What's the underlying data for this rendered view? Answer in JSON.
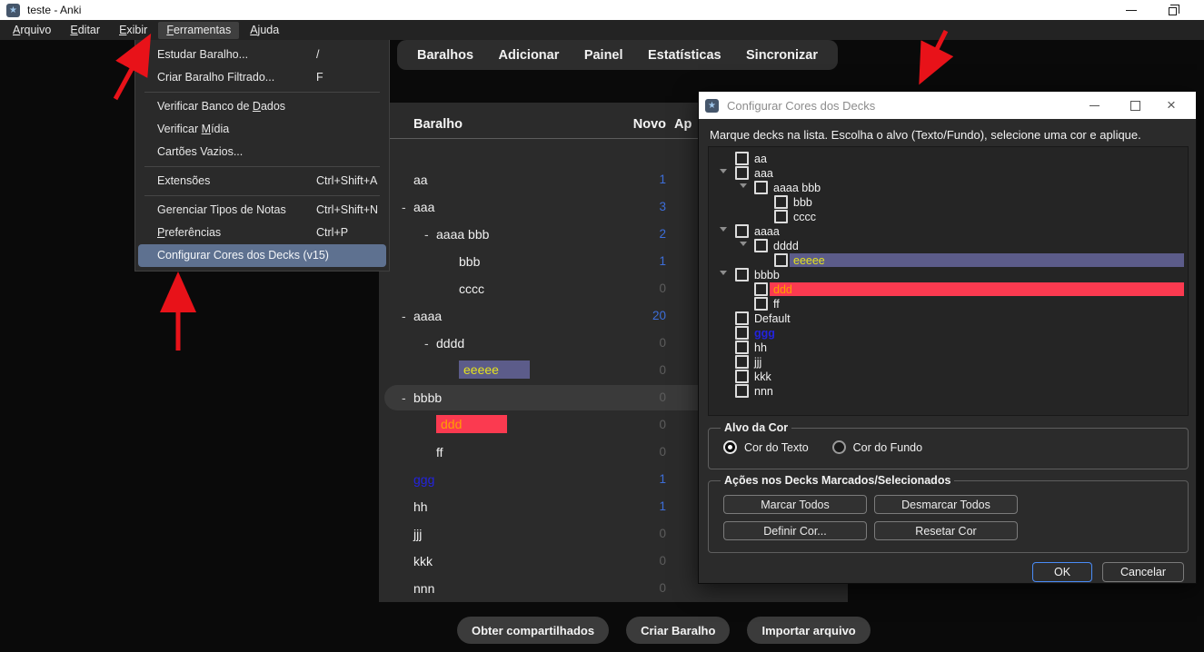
{
  "window": {
    "title": "teste - Anki"
  },
  "menubar": {
    "items": [
      {
        "label": "Arquivo",
        "accel": 0
      },
      {
        "label": "Editar",
        "accel": 0
      },
      {
        "label": "Exibir",
        "accel": 0
      },
      {
        "label": "Ferramentas",
        "accel": 0,
        "active": true
      },
      {
        "label": "Ajuda",
        "accel": 0
      }
    ]
  },
  "tools_menu": {
    "items": [
      {
        "label": "Estudar Baralho...",
        "shortcut": "/"
      },
      {
        "label": "Criar Baralho Filtrado...",
        "shortcut": "F"
      },
      {
        "sep": true
      },
      {
        "label": "Verificar Banco de Dados",
        "accel": 19
      },
      {
        "label": "Verificar Mídia",
        "accel": 10
      },
      {
        "label": "Cartões Vazios..."
      },
      {
        "sep": true
      },
      {
        "label": "Extensões",
        "shortcut": "Ctrl+Shift+A"
      },
      {
        "sep": true
      },
      {
        "label": "Gerenciar Tipos de Notas",
        "shortcut": "Ctrl+Shift+N"
      },
      {
        "label": "Preferências",
        "accel": 0,
        "shortcut": "Ctrl+P"
      },
      {
        "label": "Configurar Cores dos Decks (v15)",
        "highlighted": true
      }
    ]
  },
  "tabs": [
    "Baralhos",
    "Adicionar",
    "Painel",
    "Estatísticas",
    "Sincronizar"
  ],
  "deck_table": {
    "columns": [
      "Baralho",
      "Novo",
      "Ap"
    ],
    "rows": [
      {
        "name": "aa",
        "level": 0,
        "collapsible": false,
        "count": 1,
        "style": ""
      },
      {
        "name": "aaa",
        "level": 0,
        "collapsible": true,
        "count": 3,
        "style": ""
      },
      {
        "name": "aaaa bbb",
        "level": 1,
        "collapsible": true,
        "count": 2,
        "style": ""
      },
      {
        "name": "bbb",
        "level": 2,
        "collapsible": false,
        "count": 1,
        "style": ""
      },
      {
        "name": "cccc",
        "level": 2,
        "collapsible": false,
        "count": 0,
        "style": ""
      },
      {
        "name": "aaaa",
        "level": 0,
        "collapsible": true,
        "count": 20,
        "style": ""
      },
      {
        "name": "dddd",
        "level": 1,
        "collapsible": true,
        "count": 0,
        "style": ""
      },
      {
        "name": "eeeee",
        "level": 2,
        "collapsible": false,
        "count": 0,
        "style": "purple"
      },
      {
        "name": "bbbb",
        "level": 0,
        "collapsible": true,
        "count": 0,
        "style": "",
        "row_highlight": true
      },
      {
        "name": "ddd",
        "level": 1,
        "collapsible": false,
        "count": 0,
        "style": "red"
      },
      {
        "name": "ff",
        "level": 1,
        "collapsible": false,
        "count": 0,
        "style": ""
      },
      {
        "name": "ggg",
        "level": 0,
        "collapsible": false,
        "count": 1,
        "style": "link"
      },
      {
        "name": "hh",
        "level": 0,
        "collapsible": false,
        "count": 1,
        "style": ""
      },
      {
        "name": "jjj",
        "level": 0,
        "collapsible": false,
        "count": 0,
        "style": ""
      },
      {
        "name": "kkk",
        "level": 0,
        "collapsible": false,
        "count": 0,
        "style": ""
      },
      {
        "name": "nnn",
        "level": 0,
        "collapsible": false,
        "count": 0,
        "style": ""
      }
    ]
  },
  "footer_buttons": [
    "Obter compartilhados",
    "Criar Baralho",
    "Importar arquivo"
  ],
  "dialog": {
    "title": "Configurar Cores dos Decks",
    "instruction": "Marque decks na lista. Escolha o alvo (Texto/Fundo), selecione uma cor e aplique.",
    "tree": [
      {
        "label": "aa",
        "level": 0,
        "arrow": false,
        "style": ""
      },
      {
        "label": "aaa",
        "level": 0,
        "arrow": true,
        "style": ""
      },
      {
        "label": "aaaa bbb",
        "level": 1,
        "arrow": true,
        "style": ""
      },
      {
        "label": "bbb",
        "level": 2,
        "arrow": false,
        "style": ""
      },
      {
        "label": "cccc",
        "level": 2,
        "arrow": false,
        "style": ""
      },
      {
        "label": "aaaa",
        "level": 0,
        "arrow": true,
        "style": ""
      },
      {
        "label": "dddd",
        "level": 1,
        "arrow": true,
        "style": ""
      },
      {
        "label": "eeeee",
        "level": 2,
        "arrow": false,
        "style": "purple"
      },
      {
        "label": "bbbb",
        "level": 0,
        "arrow": true,
        "style": ""
      },
      {
        "label": "ddd",
        "level": 1,
        "arrow": false,
        "style": "red"
      },
      {
        "label": "ff",
        "level": 1,
        "arrow": false,
        "style": ""
      },
      {
        "label": "Default",
        "level": 0,
        "arrow": false,
        "style": ""
      },
      {
        "label": "ggg",
        "level": 0,
        "arrow": false,
        "style": "link"
      },
      {
        "label": "hh",
        "level": 0,
        "arrow": false,
        "style": ""
      },
      {
        "label": "jjj",
        "level": 0,
        "arrow": false,
        "style": ""
      },
      {
        "label": "kkk",
        "level": 0,
        "arrow": false,
        "style": ""
      },
      {
        "label": "nnn",
        "level": 0,
        "arrow": false,
        "style": ""
      }
    ],
    "target_group": {
      "label": "Alvo da Cor",
      "options": [
        {
          "label": "Cor do Texto",
          "selected": true
        },
        {
          "label": "Cor do Fundo",
          "selected": false
        }
      ]
    },
    "actions_group": {
      "label": "Ações nos Decks Marcados/Selecionados",
      "buttons": [
        "Marcar Todos",
        "Desmarcar Todos",
        "Definir Cor...",
        "Resetar Cor"
      ]
    },
    "ok": "OK",
    "cancel": "Cancelar"
  },
  "colors": {
    "purple_highlight": "#5c5c8a",
    "yellow_text": "#e6e31d",
    "red_highlight": "#fb3a50",
    "orange_text": "#ff9f00",
    "link_blue": "#2323dd",
    "count_blue": "#3d6ed9",
    "count_zero": "#5d5d5d",
    "menu_highlight": "#5e7190",
    "ok_border": "#4a8cf7",
    "arrow_red": "#e81219"
  }
}
